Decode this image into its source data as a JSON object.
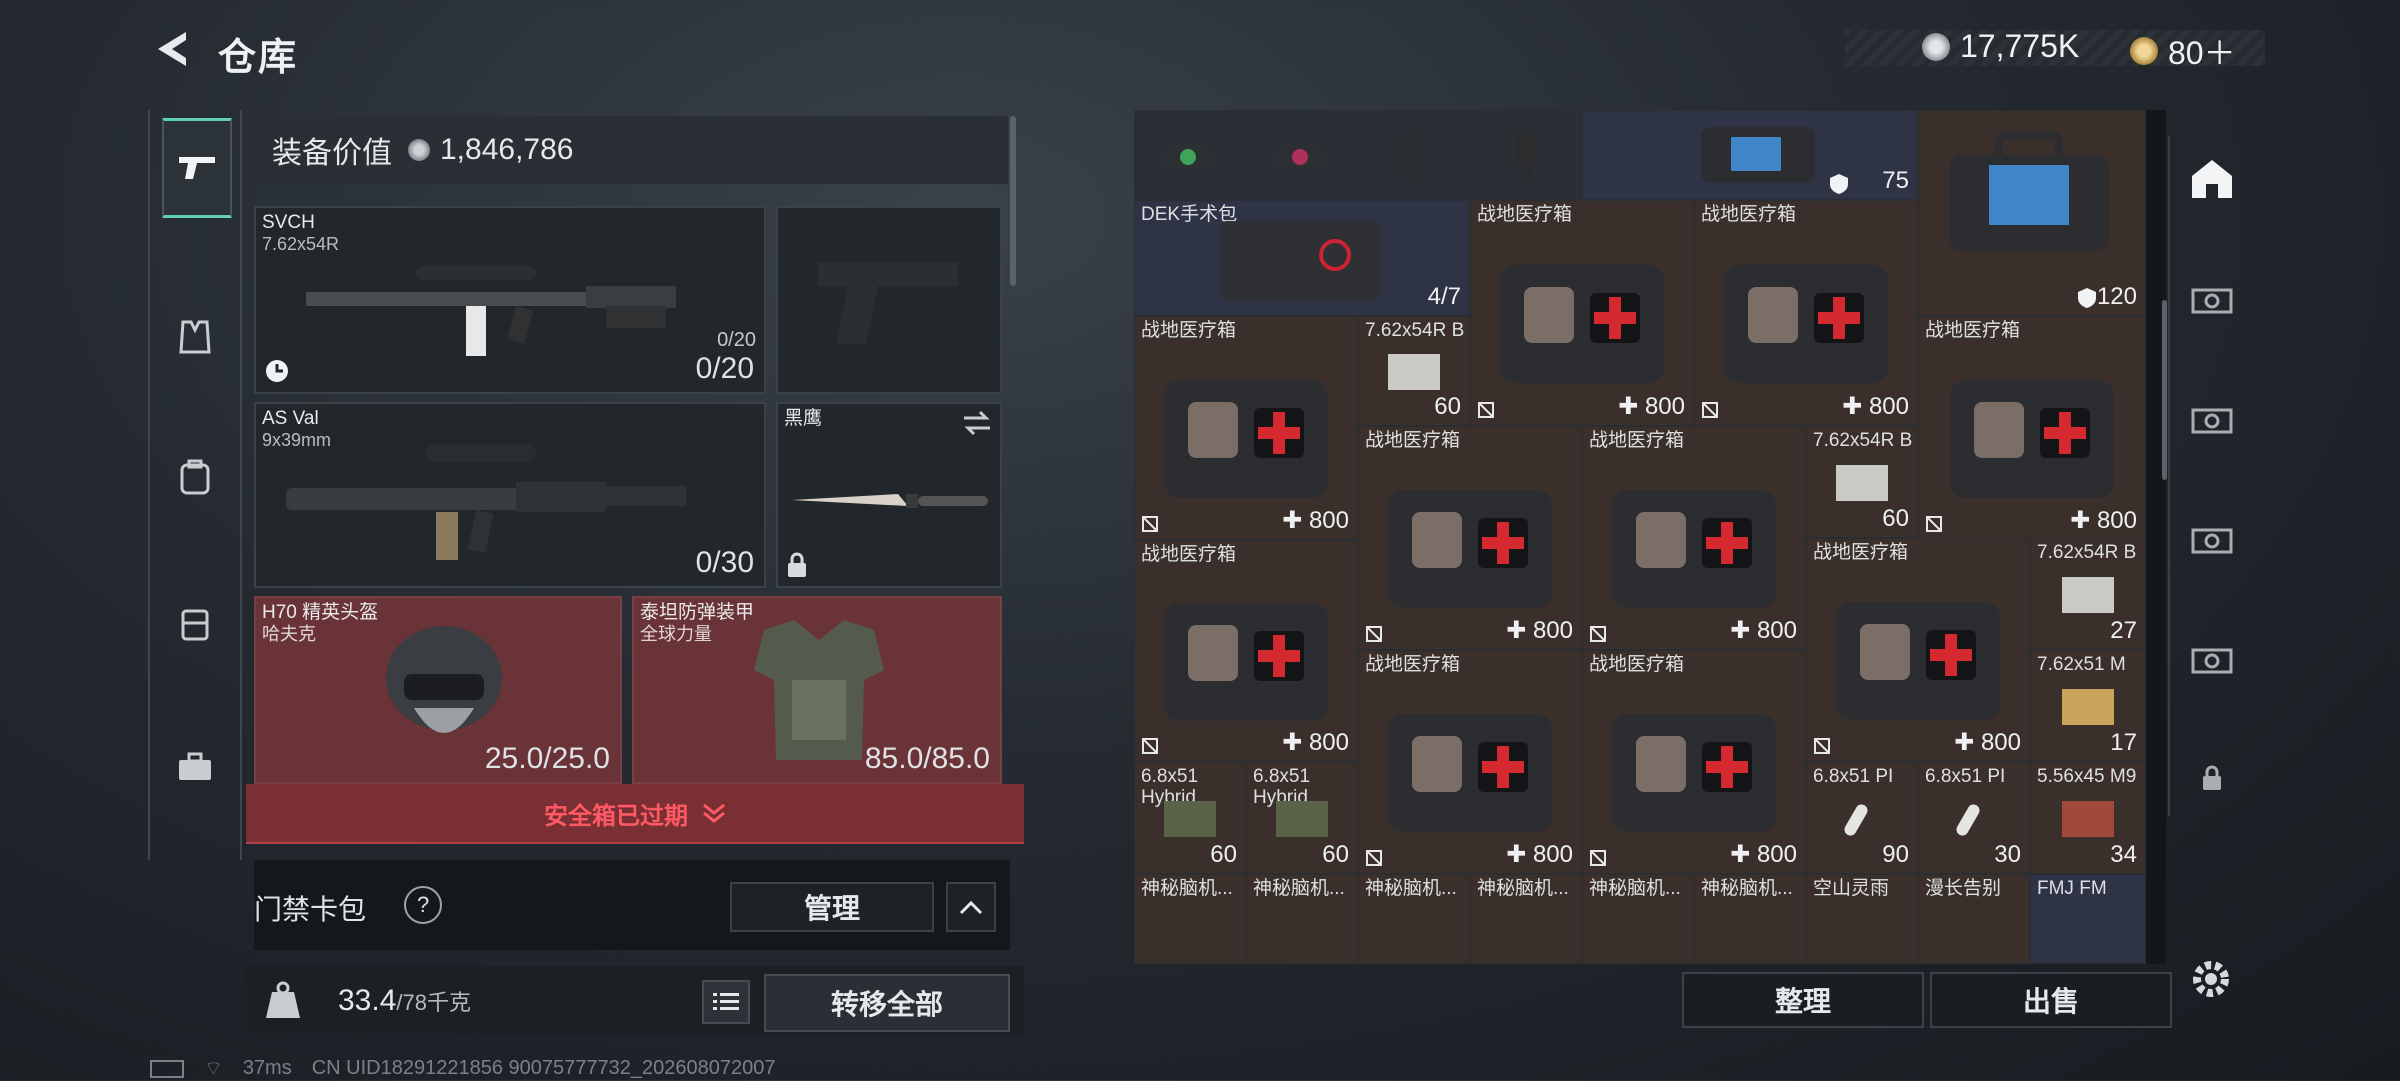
{
  "header": {
    "title": "仓库"
  },
  "currency": {
    "coins": "17,775K",
    "premium": "80＋"
  },
  "loadout": {
    "equip_value_label": "装备价值",
    "equip_value": "1,846,786",
    "slots": [
      {
        "name": "SVCH",
        "sub": "7.62x54R",
        "count": "0/20",
        "count_small": "0/20"
      },
      {
        "name": "AS Val",
        "sub": "9x39mm",
        "count": "0/30"
      },
      {
        "name": "黑鹰"
      },
      {
        "name": "H70 精英头盔",
        "sub": "哈夫克",
        "count": "25.0/25.0"
      },
      {
        "name": "泰坦防弹装甲",
        "sub": "全球力量",
        "count": "85.0/85.0"
      }
    ],
    "secure_warning": "安全箱已过期",
    "access_card_label": "门禁卡包",
    "help": "?",
    "manage_label": "管理",
    "weight": "33.4",
    "weight_max": "/78千克",
    "transfer_all": "转移全部"
  },
  "grid": {
    "top_badge_1": "75",
    "top_badge_2": "120",
    "dek_name": "DEK手术包",
    "dek_count": "4/7",
    "medkit_name": "战地医疗箱",
    "medkit_qty": "800",
    "ammo_1_name": "7.62x54R B",
    "ammo_1_qty": "60",
    "ammo_2_name": "7.62x54R B",
    "ammo_2_qty": "60",
    "ammo_3_name": "7.62x54R B",
    "ammo_3_qty": "27",
    "ammo_4_name": "7.62x51 M",
    "ammo_4_qty": "17",
    "ammo_5_name": "6.8x51 Hybrid",
    "ammo_5_qty": "60",
    "ammo_6_name": "6.8x51 Hybrid",
    "ammo_6_qty": "60",
    "ammo_7_name": "6.8x51 PI",
    "ammo_7_qty": "90",
    "ammo_8_name": "6.8x51 PI",
    "ammo_8_qty": "30",
    "ammo_9_name": "5.56x45 M9",
    "ammo_9_qty": "34",
    "watch_name": "神秘脑机...",
    "drink_1": "空山灵雨",
    "drink_2": "漫长告别",
    "fmj": "FMJ FM"
  },
  "actions": {
    "arrange": "整理",
    "sell": "出售"
  },
  "footer": {
    "ping": "37ms",
    "uid": "CN UID18291221856 90075777732_202608072007"
  },
  "colors": {
    "accent": "#5fd0b0",
    "warning": "#ff5a63",
    "medkit_red": "#d42a2f"
  }
}
